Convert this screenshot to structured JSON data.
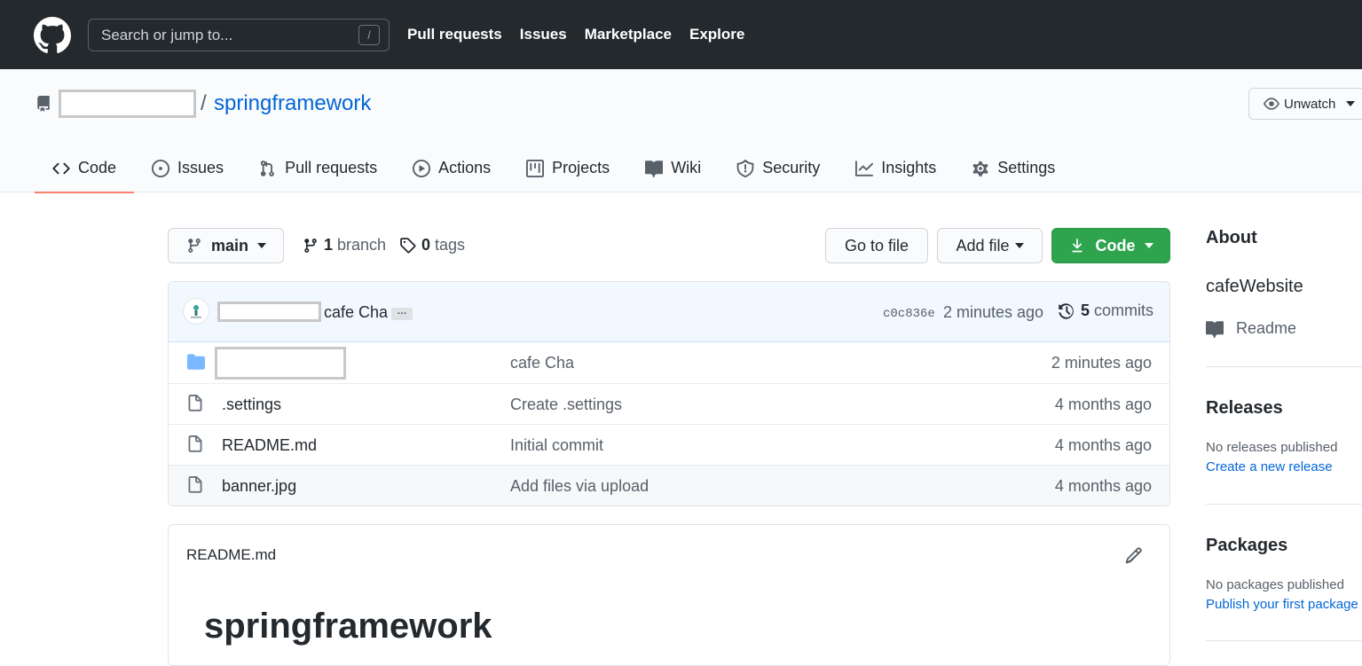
{
  "header": {
    "search_placeholder": "Search or jump to...",
    "search_shortcut": "/",
    "nav": [
      "Pull requests",
      "Issues",
      "Marketplace",
      "Explore"
    ]
  },
  "repo": {
    "separator": "/",
    "name": "springframework",
    "unwatch_label": "Unwatch"
  },
  "tabs": [
    {
      "label": "Code",
      "icon": "code-icon",
      "active": true
    },
    {
      "label": "Issues",
      "icon": "issue-icon"
    },
    {
      "label": "Pull requests",
      "icon": "pull-request-icon"
    },
    {
      "label": "Actions",
      "icon": "play-icon"
    },
    {
      "label": "Projects",
      "icon": "project-icon"
    },
    {
      "label": "Wiki",
      "icon": "book-icon"
    },
    {
      "label": "Security",
      "icon": "shield-icon"
    },
    {
      "label": "Insights",
      "icon": "graph-icon"
    },
    {
      "label": "Settings",
      "icon": "gear-icon"
    }
  ],
  "toolbar": {
    "branch": "main",
    "branch_count": "1",
    "branch_label": "branch",
    "tag_count": "0",
    "tag_label": "tags",
    "goto_file": "Go to file",
    "add_file": "Add file",
    "code": "Code"
  },
  "latest_commit": {
    "message": "cafe Cha",
    "ellipsis": "…",
    "sha": "c0c836e",
    "time": "2 minutes ago",
    "commit_count": "5",
    "commit_label": "commits"
  },
  "files": [
    {
      "type": "dir",
      "name": "",
      "message": "cafe Cha",
      "time": "2 minutes ago"
    },
    {
      "type": "file",
      "name": ".settings",
      "message": "Create .settings",
      "time": "4 months ago"
    },
    {
      "type": "file",
      "name": "README.md",
      "message": "Initial commit",
      "time": "4 months ago"
    },
    {
      "type": "file",
      "name": "banner.jpg",
      "message": "Add files via upload",
      "time": "4 months ago"
    }
  ],
  "readme": {
    "title": "README.md",
    "heading": "springframework"
  },
  "sidebar": {
    "about_title": "About",
    "description": "cafeWebsite",
    "readme_label": "Readme",
    "releases_title": "Releases",
    "releases_note": "No releases published",
    "releases_link": "Create a new release",
    "packages_title": "Packages",
    "packages_note": "No packages published",
    "packages_link": "Publish your first package"
  },
  "colors": {
    "header_bg": "#24292e",
    "link": "#0366d6",
    "primary_button": "#2ea44f",
    "active_tab_underline": "#f9826c",
    "commit_bar_bg": "#f1f8ff"
  }
}
